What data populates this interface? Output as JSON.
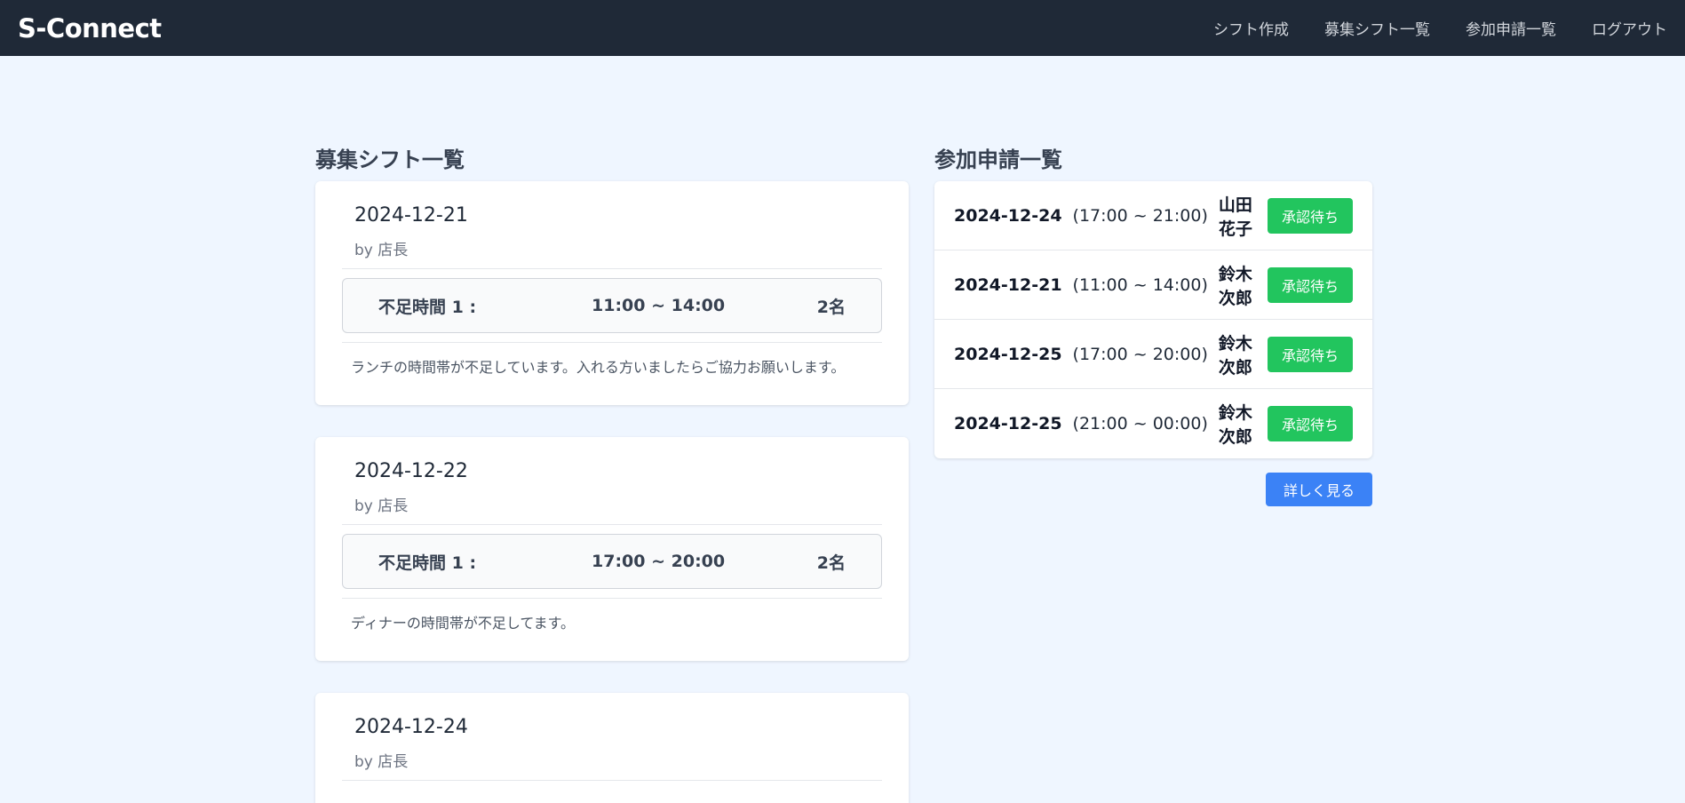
{
  "nav": {
    "brand": "S-Connect",
    "links": [
      "シフト作成",
      "募集シフト一覧",
      "参加申請一覧",
      "ログアウト"
    ]
  },
  "recruit": {
    "title": "募集シフト一覧",
    "shifts": [
      {
        "date": "2024-12-21",
        "by": "by 店長",
        "slot_label": "不足時間 1 :",
        "slot_time": "11:00 ~ 14:00",
        "slot_count": "2名",
        "note": "ランチの時間帯が不足しています。入れる方いましたらご協力お願いします。"
      },
      {
        "date": "2024-12-22",
        "by": "by 店長",
        "slot_label": "不足時間 1 :",
        "slot_time": "17:00 ~ 20:00",
        "slot_count": "2名",
        "note": "ディナーの時間帯が不足してます。"
      },
      {
        "date": "2024-12-24",
        "by": "by 店長"
      }
    ]
  },
  "applications": {
    "title": "参加申請一覧",
    "items": [
      {
        "date": "2024-12-24",
        "time": "(17:00 ~ 21:00)",
        "name": "山田 花子",
        "status": "承認待ち"
      },
      {
        "date": "2024-12-21",
        "time": "(11:00 ~ 14:00)",
        "name": "鈴木 次郎",
        "status": "承認待ち"
      },
      {
        "date": "2024-12-25",
        "time": "(17:00 ~ 20:00)",
        "name": "鈴木 次郎",
        "status": "承認待ち"
      },
      {
        "date": "2024-12-25",
        "time": "(21:00 ~ 00:00)",
        "name": "鈴木 次郎",
        "status": "承認待ち"
      }
    ],
    "more_label": "詳しく見る"
  },
  "colors": {
    "navbar": "#1f2937",
    "background": "#eff6ff",
    "badge": "#22c55e",
    "button": "#3b82f6"
  }
}
